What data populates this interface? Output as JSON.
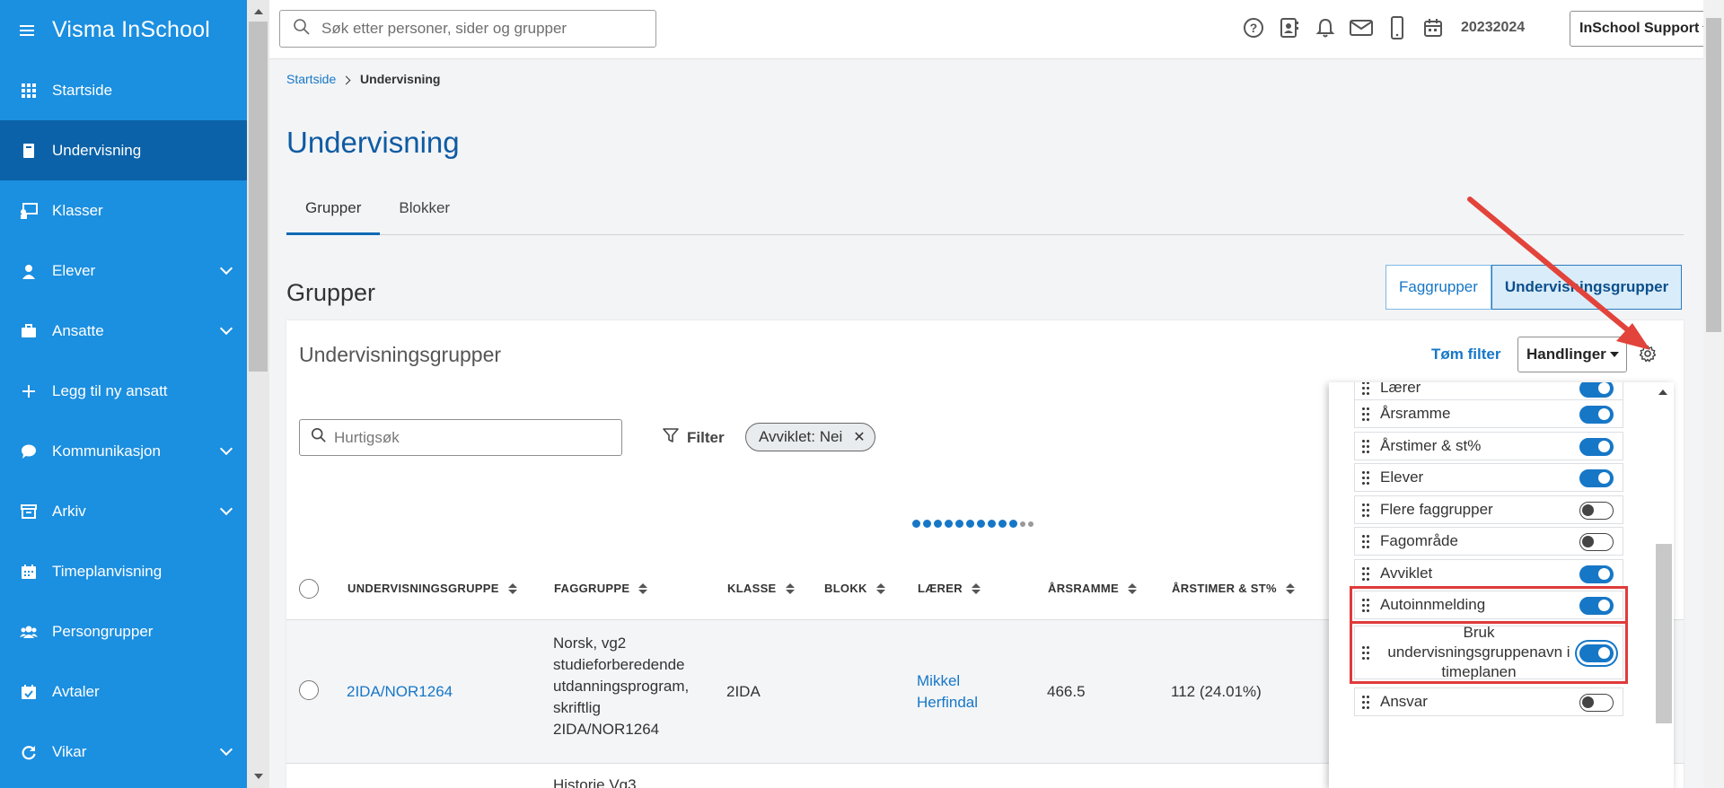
{
  "app": {
    "title": "Visma InSchool"
  },
  "sidebar": {
    "items": [
      {
        "label": "Startside",
        "icon": "grid-icon",
        "expandable": false
      },
      {
        "label": "Undervisning",
        "icon": "book-icon",
        "expandable": false,
        "active": true
      },
      {
        "label": "Klasser",
        "icon": "presentation-icon",
        "expandable": false
      },
      {
        "label": "Elever",
        "icon": "student-icon",
        "expandable": true
      },
      {
        "label": "Ansatte",
        "icon": "briefcase-icon",
        "expandable": true
      },
      {
        "label": "Legg til ny ansatt",
        "icon": "plus-icon",
        "expandable": false
      },
      {
        "label": "Kommunikasjon",
        "icon": "chat-icon",
        "expandable": true
      },
      {
        "label": "Arkiv",
        "icon": "archive-icon",
        "expandable": true
      },
      {
        "label": "Timeplanvisning",
        "icon": "calendar-icon",
        "expandable": false
      },
      {
        "label": "Persongrupper",
        "icon": "people-icon",
        "expandable": false
      },
      {
        "label": "Avtaler",
        "icon": "calendar-check-icon",
        "expandable": false
      },
      {
        "label": "Vikar",
        "icon": "refresh-icon",
        "expandable": true
      }
    ]
  },
  "topbar": {
    "search_placeholder": "Søk etter personer, sider og grupper",
    "school_year": "20232024",
    "user_menu": "InSchool Support"
  },
  "breadcrumb": {
    "home": "Startside",
    "current": "Undervisning"
  },
  "page": {
    "title": "Undervisning",
    "tabs": [
      {
        "label": "Grupper",
        "active": true
      },
      {
        "label": "Blokker",
        "active": false
      }
    ],
    "section_title": "Grupper",
    "segment": {
      "left": "Faggrupper",
      "right": "Undervisningsgrupper"
    }
  },
  "card": {
    "title": "Undervisningsgrupper",
    "clear_filter": "Tøm filter",
    "actions": "Handlinger",
    "quick_search_placeholder": "Hurtigsøk",
    "filter_label": "Filter",
    "filter_chip": "Avviklet: Nei"
  },
  "table": {
    "columns": [
      "UNDERVISNINGSGRUPPE",
      "FAGGRUPPE",
      "KLASSE",
      "BLOKK",
      "LÆRER",
      "ÅRSRAMME",
      "ÅRSTIMER & ST%"
    ],
    "rows": [
      {
        "group": "2IDA/NOR1264",
        "subject_lines": [
          "Norsk, vg2",
          "studieforberedende",
          "utdanningsprogram,",
          "skriftlig",
          "2IDA/NOR1264"
        ],
        "class": "2IDA",
        "block": "",
        "teacher_lines": [
          "Mikkel",
          "Herfindal"
        ],
        "year_frame": "466.5",
        "year_hours": "112 (24.01%)"
      }
    ],
    "next_row_subject": "Historie Vg3"
  },
  "column_panel": {
    "items": [
      {
        "label": "Lærer",
        "on": true
      },
      {
        "label": "Årsramme",
        "on": true
      },
      {
        "label": "Årstimer & st%",
        "on": true
      },
      {
        "label": "Elever",
        "on": true
      },
      {
        "label": "Flere faggrupper",
        "on": false
      },
      {
        "label": "Fagområde",
        "on": false
      },
      {
        "label": "Avviklet",
        "on": true
      },
      {
        "label": "Autoinnmelding",
        "on": true,
        "highlight": true
      },
      {
        "label": "Bruk undervisningsgruppenavn i timeplanen",
        "on": true,
        "highlight": true,
        "focused": true
      },
      {
        "label": "Ansvar",
        "on": false
      }
    ]
  },
  "colors": {
    "sidebar": "#1b8fe0",
    "sidebar_active": "#0b62a8",
    "accent": "#1677c7",
    "highlight": "#e03a3a"
  }
}
